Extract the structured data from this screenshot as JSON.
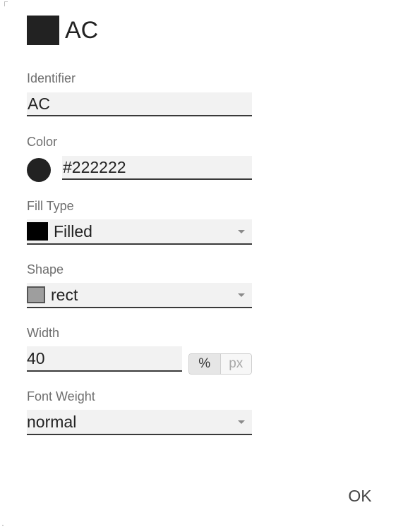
{
  "header": {
    "swatch_color": "#222222",
    "title": "AC"
  },
  "fields": {
    "identifier": {
      "label": "Identifier",
      "value": "AC"
    },
    "color": {
      "label": "Color",
      "value": "#222222",
      "swatch_color": "#222222"
    },
    "fill_type": {
      "label": "Fill Type",
      "value": "Filled",
      "swatch_color": "#000000"
    },
    "shape": {
      "label": "Shape",
      "value": "rect",
      "swatch_color": "#9e9e9e"
    },
    "width": {
      "label": "Width",
      "value": "40",
      "units": [
        "%",
        "px"
      ],
      "selected_unit": "%"
    },
    "font_weight": {
      "label": "Font Weight",
      "value": "normal"
    }
  },
  "footer": {
    "ok_label": "OK"
  }
}
